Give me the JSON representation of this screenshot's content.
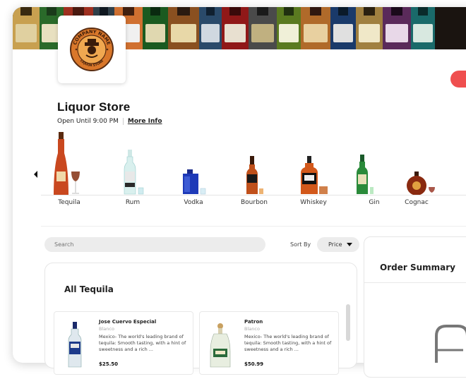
{
  "store": {
    "title": "Liquor Store",
    "hours": "Open Until 9:00 PM",
    "more_info": "More Info",
    "logo_text_top": "COMPANY NAME",
    "logo_text_bottom": "LIQUOR STORE"
  },
  "categories": [
    {
      "label": "Tequila"
    },
    {
      "label": "Rum"
    },
    {
      "label": "Vodka"
    },
    {
      "label": "Bourbon"
    },
    {
      "label": "Whiskey"
    },
    {
      "label": "Gin"
    },
    {
      "label": "Cognac"
    }
  ],
  "search": {
    "placeholder": "Search"
  },
  "sort": {
    "label": "Sort By",
    "value": "Price"
  },
  "products_panel": {
    "title": "All Tequila",
    "items": [
      {
        "name": "Jose Cuervo Especial",
        "type": "Blanco",
        "description": "Mexico- The world's leading brand of tequila: Smooth tasting, with a hint of sweetness and a rich ...",
        "price": "$25.50"
      },
      {
        "name": "Patron",
        "type": "Blanco",
        "description": "Mexico- The world's leading brand of tequila: Smooth tasting, with a hint of sweetness and a rich ...",
        "price": "$50.99"
      }
    ]
  },
  "order_summary": {
    "title": "Order Summary"
  },
  "colors": {
    "accent_red": "#ef4f4f",
    "logo_orange": "#d9772a",
    "logo_brown": "#5a2d12"
  }
}
